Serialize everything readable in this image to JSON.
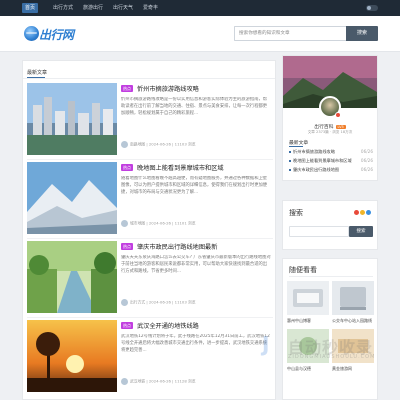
{
  "topnav": {
    "items": [
      "首页",
      "出行方式",
      "旅游出行",
      "出行天气",
      "爱奇丰"
    ]
  },
  "header": {
    "logo_text": "出行网",
    "search_placeholder": "搜索你想看的知识和文章",
    "search_button": "搜索"
  },
  "main": {
    "section_title": "最新文章",
    "articles": [
      {
        "tag": "热点",
        "title": "忻州市摘旅游路线攻略",
        "excerpt": "忻州市摘旅游路线攻略是一份以实用信息和游客实际体验为主的旅游指南，帮助读者在出行前了解当地的交通、住宿、景点与美食安排，让每一次行程都更加顺畅，轻松规划属于自己的精彩旅程...",
        "author": "南路地图",
        "date": "2024-06-26",
        "views": "11103 浏览"
      },
      {
        "tag": "热点",
        "title": "晚地图上能看到景摩城市和区域",
        "excerpt": "随着地图什么地图看晚不越高越便，而有疑地图服务，并通过各种数据和卫星图像，可以为用户提供城市和区域的详细信息，使得我们在规划出行时更加便捷，对城市的布局与交通状况更为了解...",
        "author": "城市地图",
        "date": "2024-06-26",
        "views": "11101 浏览"
      },
      {
        "tag": "热点",
        "title": "肇庆市政民出行路线地图最新",
        "excerpt": "肇庆天天东泉庆海路口怎么去公交车? 广东省肇庆市最新版本的出行路线地图对于前往当地的游客和居民来说都非常实用，可以帮助大家快速找到最合适的出行方式和路线，节省更多时间...",
        "author": "出行方式",
        "date": "2024-06-26",
        "views": "11103 浏览"
      },
      {
        "tag": "热点",
        "title": "武汉全开通的地铁线路",
        "excerpt": "武汉地铁12号线计划将于年，此于线路在2025年12月31日前工，武汉地铁12号线全开通后将大幅改善城市交通出行条件，进一步提高，武汉地铁交通系统将更趋完善...",
        "author": "武汉地铁",
        "date": "2024-06-26",
        "views": "11128 浏览"
      }
    ]
  },
  "profile": {
    "name": "出行百科",
    "level": "LV5",
    "stats": "文章 2373篇 · 浏览 18万次",
    "recent_title": "最新文章",
    "recent": [
      {
        "title": "忻州市摘旅游路线攻略",
        "date": "06/26"
      },
      {
        "title": "晚地图上能看到景摩城市和区域",
        "date": "06/26"
      },
      {
        "title": "肇庆市政民出行路线地图",
        "date": "06/26"
      }
    ]
  },
  "search_widget": {
    "heading": "搜索",
    "button": "搜索",
    "dot_colors": [
      "#e84a3a",
      "#f0b52a",
      "#3a8fe0"
    ]
  },
  "hot": {
    "heading": "随便看看",
    "tiles": [
      {
        "label": "惠州中山博客"
      },
      {
        "label": "公交车中心站入园路线"
      },
      {
        "label": "中山县与汉德"
      },
      {
        "label": "黄金旅游网"
      }
    ]
  },
  "watermark": {
    "brand": "自动秒收录",
    "sub": "ZIDONGMIAOSHOULU.COM"
  }
}
